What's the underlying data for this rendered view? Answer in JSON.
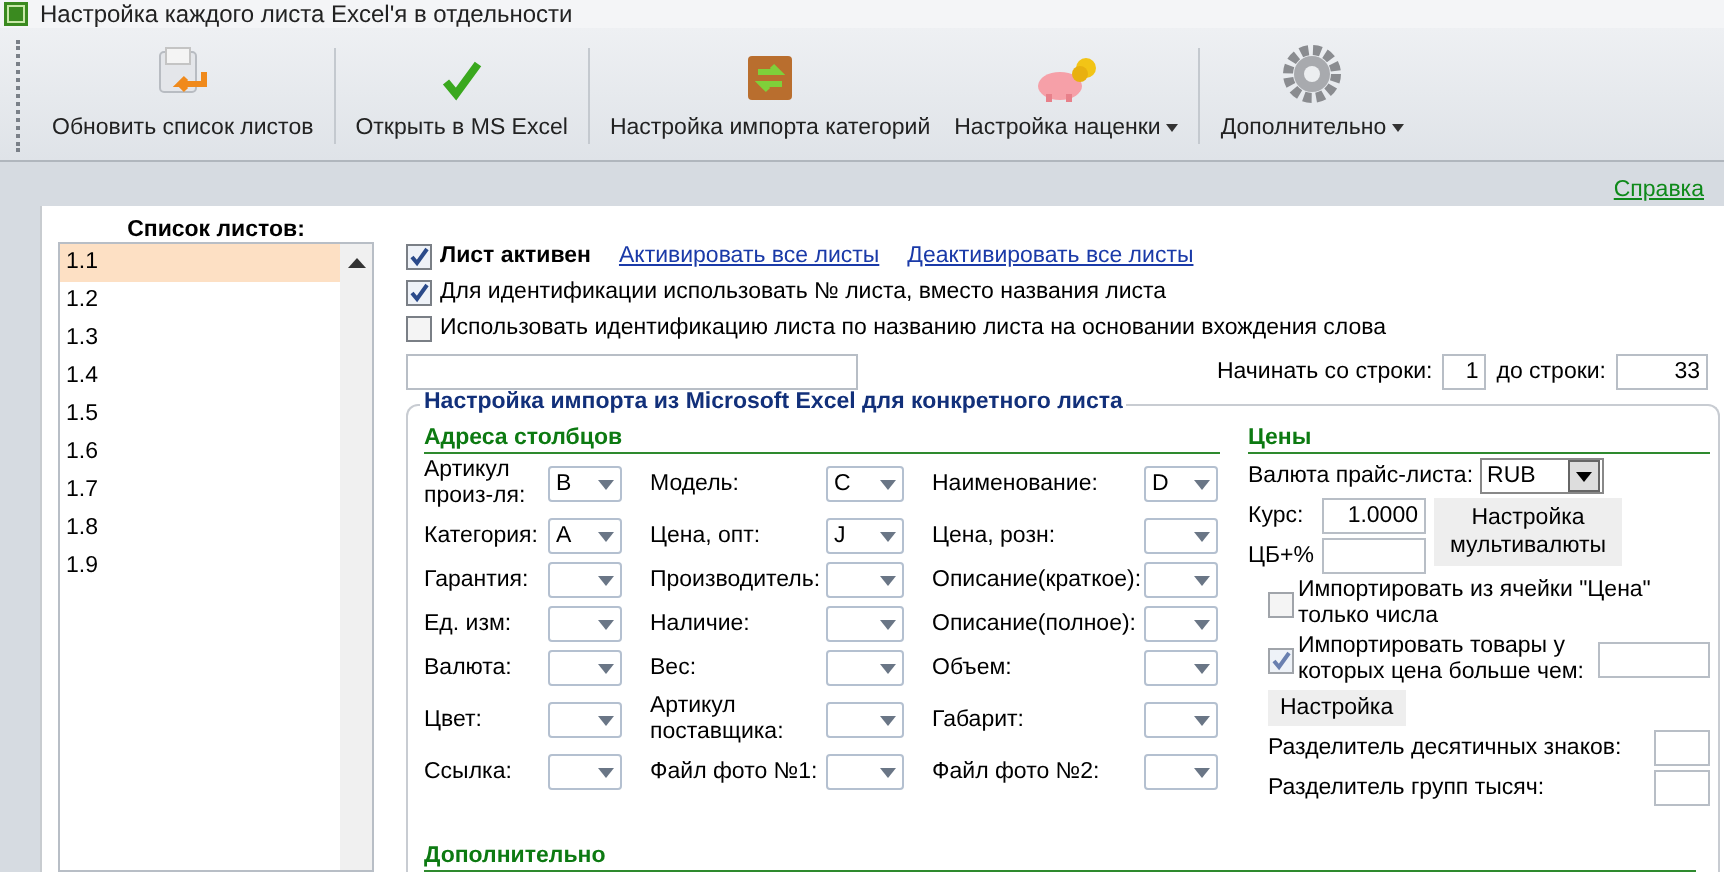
{
  "window": {
    "title": "Настройка каждого листа Excel'я в отдельности"
  },
  "toolbar": [
    {
      "label": "Обновить список листов",
      "kind": "refresh",
      "dropdown": false
    },
    {
      "label": "Открыть в MS Excel",
      "kind": "check",
      "dropdown": false
    },
    {
      "label": "Настройка импорта категорий",
      "kind": "box",
      "dropdown": false
    },
    {
      "label": "Настройка наценки",
      "kind": "piggy",
      "dropdown": true
    },
    {
      "label": "Дополнительно",
      "kind": "gear",
      "dropdown": true
    }
  ],
  "help_link": "Справка",
  "sheet_list": {
    "title": "Список листов:",
    "items": [
      {
        "label": "1.1",
        "selected": true
      },
      {
        "label": "1.2",
        "selected": false
      },
      {
        "label": "1.3",
        "selected": false
      },
      {
        "label": "1.4",
        "selected": false
      },
      {
        "label": "1.5",
        "selected": false
      },
      {
        "label": "1.6",
        "selected": false
      },
      {
        "label": "1.7",
        "selected": false
      },
      {
        "label": "1.8",
        "selected": false
      },
      {
        "label": "1.9",
        "selected": false
      }
    ]
  },
  "options": [
    {
      "label": "Лист активен",
      "checked": true,
      "links": [
        "Активировать все листы",
        "Деактивировать все листы"
      ]
    },
    {
      "label": "Для идентификации использовать № листа, вместо названия листа",
      "checked": true
    },
    {
      "label": "Использовать идентификацию листа по названию листа на основании вхождения слова",
      "checked": false
    }
  ],
  "row_range": {
    "start_label": "Начинать со строки:",
    "start": "1",
    "end_label": "до строки:",
    "end": "33"
  },
  "import_group": {
    "title": "Настройка импорта из Microsoft Excel для конкретного листа",
    "columns_heading": "Адреса столбцов",
    "column_fields": [
      {
        "label": "Артикул произ-ля:",
        "value": "B"
      },
      {
        "label": "Модель:",
        "value": "C"
      },
      {
        "label": "Наименование:",
        "value": "D"
      },
      {
        "label": "Категория:",
        "value": "A"
      },
      {
        "label": "Цена, опт:",
        "value": "J"
      },
      {
        "label": "Цена, розн:"
      },
      {
        "label": "Гарантия:"
      },
      {
        "label": "Производитель:"
      },
      {
        "label": "Описание(краткое):"
      },
      {
        "label": "Ед. изм:"
      },
      {
        "label": "Наличие:"
      },
      {
        "label": "Описание(полное):"
      },
      {
        "label": "Валюта:"
      },
      {
        "label": "Вес:"
      },
      {
        "label": "Объем:"
      },
      {
        "label": "Цвет:"
      },
      {
        "label": "Артикул поставщика:"
      },
      {
        "label": "Габарит:"
      },
      {
        "label": "Ссылка:"
      },
      {
        "label": "Файл фото №1:"
      },
      {
        "label": "Файл фото №2:"
      }
    ],
    "prices": {
      "heading": "Цены",
      "currency_label": "Валюта прайс-листа:",
      "currency": "RUB",
      "rate_label": "Курс:",
      "rate": "1.0000",
      "cb_label": "ЦБ+%",
      "multicurrency_button": "Настройка мультивалюты",
      "numbers_only": {
        "label": "Импортировать из ячейки \"Цена\" только числа",
        "checked": false
      },
      "min_price": {
        "label": "Импортировать товары у которых цена больше чем:",
        "checked": true
      },
      "settings_button": "Настройка",
      "decimal_sep_label": "Разделитель десятичных знаков:",
      "thousands_sep_label": "Разделитель групп тысяч:"
    },
    "extra_heading": "Дополнительно"
  }
}
